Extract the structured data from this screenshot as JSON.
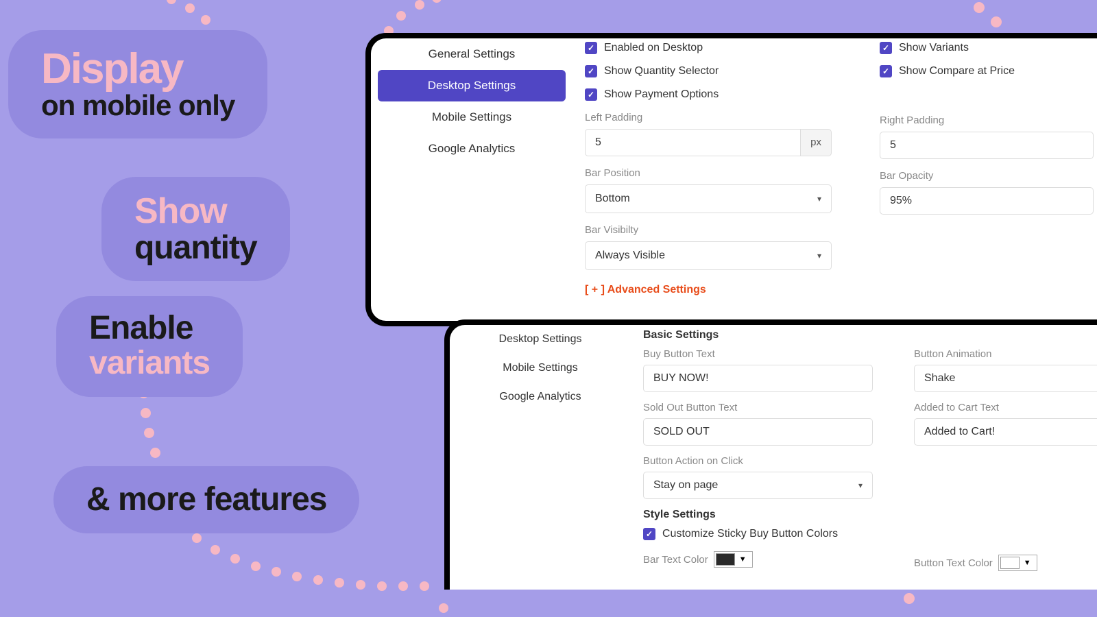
{
  "badges": {
    "b1_line1": "Display",
    "b1_line2": "on mobile only",
    "b2_line1": "Show",
    "b2_line2": "quantity",
    "b3_line1": "Enable",
    "b3_line2": "variants",
    "b4": "& more features"
  },
  "panel1": {
    "nav": [
      "General Settings",
      "Desktop Settings",
      "Mobile Settings",
      "Google Analytics"
    ],
    "chk_enabled": "Enabled on Desktop",
    "chk_qty": "Show Quantity Selector",
    "chk_pay": "Show Payment Options",
    "chk_variants": "Show Variants",
    "chk_compare": "Show Compare at Price",
    "left_padding_label": "Left Padding",
    "left_padding_value": "5",
    "left_padding_unit": "px",
    "right_padding_label": "Right Padding",
    "right_padding_value": "5",
    "bar_position_label": "Bar Position",
    "bar_position_value": "Bottom",
    "bar_opacity_label": "Bar Opacity",
    "bar_opacity_value": "95%",
    "bar_visibility_label": "Bar Visibilty",
    "bar_visibility_value": "Always Visible",
    "advanced": "[ + ] Advanced Settings"
  },
  "panel2": {
    "nav": [
      "Desktop Settings",
      "Mobile Settings",
      "Google Analytics"
    ],
    "basic_title": "Basic Settings",
    "buy_button_label": "Buy Button Text",
    "buy_button_value": "BUY NOW!",
    "button_anim_label": "Button Animation",
    "button_anim_value": "Shake",
    "sold_out_label": "Sold Out Button Text",
    "sold_out_value": "SOLD OUT",
    "added_cart_label": "Added to Cart Text",
    "added_cart_value": "Added to Cart!",
    "action_label": "Button Action on Click",
    "action_value": "Stay on page",
    "style_title": "Style Settings",
    "customize_chk": "Customize Sticky Buy Button Colors",
    "bar_text_color_label": "Bar Text Color",
    "bar_text_color": "#2a2a2a",
    "button_text_color_label": "Button Text Color",
    "button_text_color": "#ffffff"
  }
}
